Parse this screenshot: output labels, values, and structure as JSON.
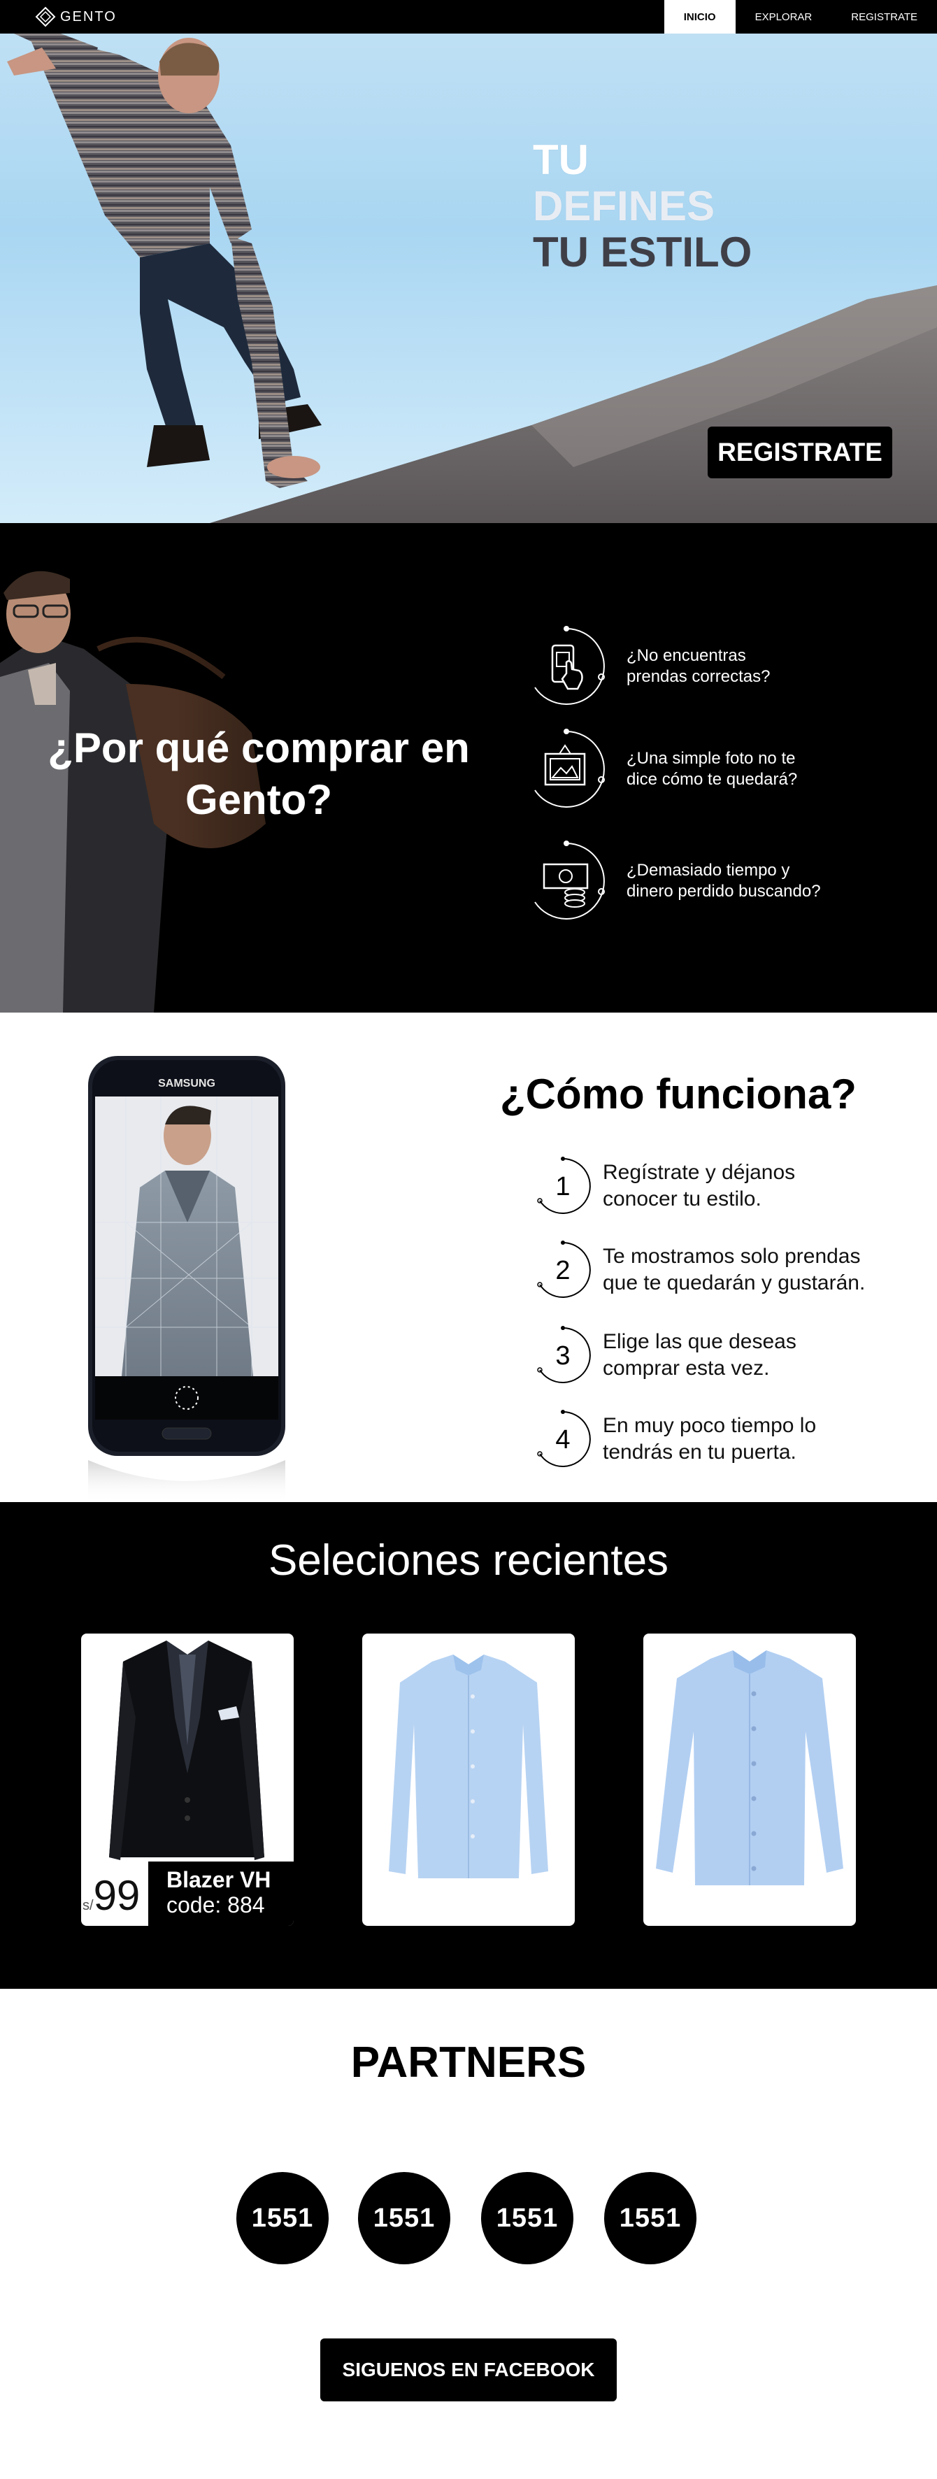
{
  "nav": {
    "brand": "GENTO",
    "items": [
      {
        "label": "INICIO",
        "active": true
      },
      {
        "label": "EXPLORAR",
        "active": false
      },
      {
        "label": "REGISTRATE",
        "active": false
      }
    ]
  },
  "hero": {
    "title_line1": "TU",
    "title_line2": "DEFINES",
    "title_line3": "TU ESTILO",
    "cta": "REGISTRATE"
  },
  "why": {
    "title": "¿Por qué comprar en Gento?",
    "items": [
      {
        "icon": "phone-touch-icon",
        "text": "¿No encuentras prendas correctas?"
      },
      {
        "icon": "picture-frame-icon",
        "text": "¿Una simple foto no te dice cómo te quedará?"
      },
      {
        "icon": "money-icon",
        "text": "¿Demasiado tiempo y dinero perdido buscando?"
      }
    ]
  },
  "how": {
    "title": "¿Cómo funciona?",
    "phone_brand": "SAMSUNG",
    "steps": [
      {
        "number": "1",
        "text": "Regístrate y déjanos conocer tu estilo."
      },
      {
        "number": "2",
        "text": "Te mostramos solo prendas que te quedarán y gustarán."
      },
      {
        "number": "3",
        "text": "Elige las que deseas comprar esta vez."
      },
      {
        "number": "4",
        "text": "En muy poco tiempo lo tendrás en tu puerta."
      }
    ]
  },
  "recent": {
    "title": "Seleciones recientes",
    "products": [
      {
        "image": "blazer",
        "currency": "s/",
        "price": "99",
        "name": "Blazer VH",
        "code": "code: 884"
      },
      {
        "image": "light-blue-shirt"
      },
      {
        "image": "light-blue-shirt-fitted"
      }
    ]
  },
  "partners": {
    "title": "PARTNERS",
    "logos": [
      "1551",
      "1551",
      "1551",
      "1551"
    ],
    "cta": "SIGUENOS EN FACEBOOK"
  },
  "colors": {
    "primary": "#000000",
    "background": "#ffffff",
    "sky": "#a9d6f2",
    "shirt_blue": "#b7d3f3"
  }
}
